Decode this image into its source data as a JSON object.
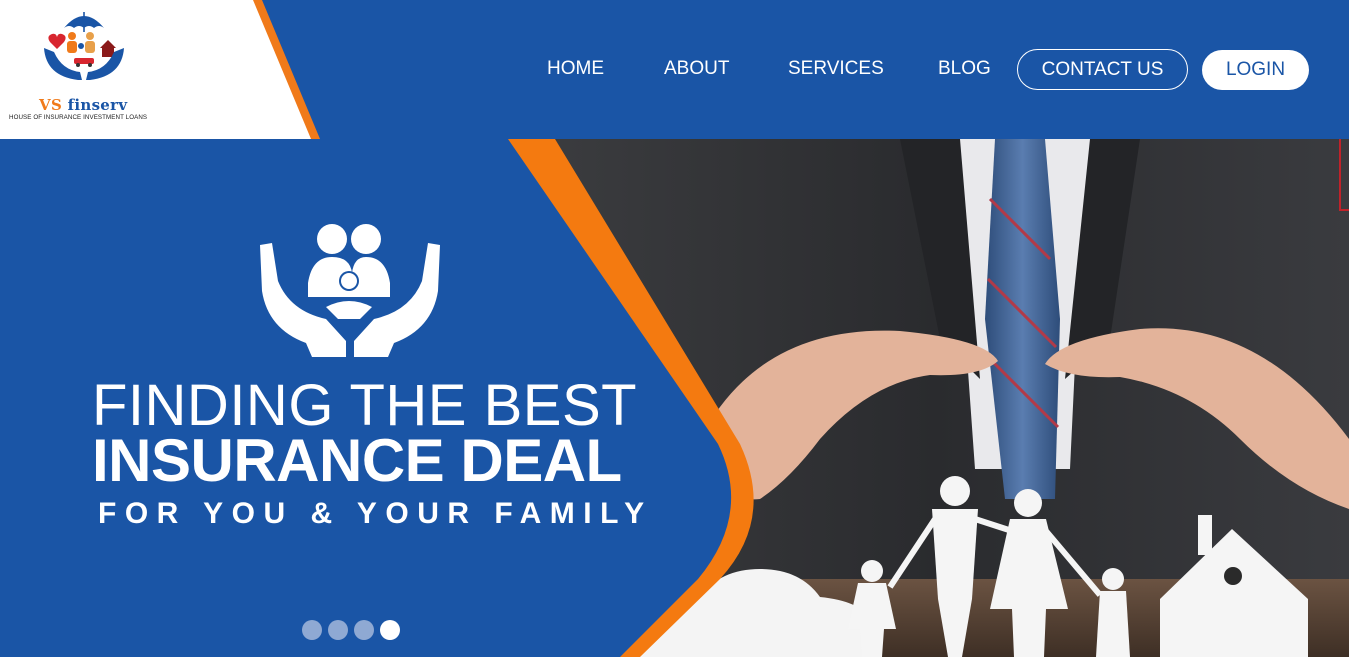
{
  "brand": {
    "name_prefix": "VS",
    "name_suffix": "finserv",
    "tagline": "HOUSE OF INSURANCE INVESTMENT LOANS",
    "colors": {
      "primary": "#1a55a6",
      "accent": "#f07a1a",
      "white": "#ffffff"
    }
  },
  "nav": {
    "items": [
      {
        "label": "HOME"
      },
      {
        "label": "ABOUT"
      },
      {
        "label": "SERVICES"
      },
      {
        "label": "BLOG"
      }
    ],
    "contact_label": "CONTACT US",
    "login_label": "LOGIN"
  },
  "hero": {
    "line1": "FINDING THE BEST",
    "line2": "INSURANCE DEAL",
    "line3": "FOR YOU & YOUR FAMILY",
    "icon": "family-protection-hands-icon",
    "slider": {
      "count": 4,
      "active": 4
    }
  }
}
